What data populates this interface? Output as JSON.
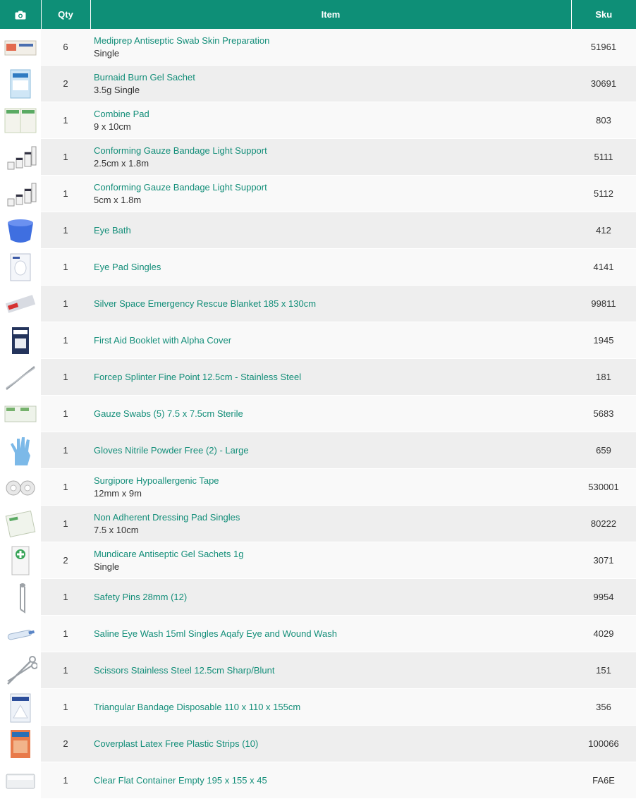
{
  "header": {
    "camera_icon": "camera-icon",
    "qty": "Qty",
    "item": "Item",
    "sku": "Sku"
  },
  "colors": {
    "header_bg": "#0e8f77",
    "link": "#138e79"
  },
  "rows": [
    {
      "qty": "6",
      "name": "Mediprep Antiseptic Swab Skin Preparation",
      "variant": "Single",
      "sku": "51961",
      "icon": "swab-box-icon"
    },
    {
      "qty": "2",
      "name": "Burnaid Burn Gel Sachet",
      "variant": "3.5g Single",
      "sku": "30691",
      "icon": "gel-sachet-icon"
    },
    {
      "qty": "1",
      "name": "Combine Pad",
      "variant": "9 x 10cm",
      "sku": "803",
      "icon": "combine-pad-icon"
    },
    {
      "qty": "1",
      "name": "Conforming Gauze Bandage Light Support",
      "variant": "2.5cm x 1.8m",
      "sku": "5111",
      "icon": "bandage-rolls-icon"
    },
    {
      "qty": "1",
      "name": "Conforming Gauze Bandage Light Support",
      "variant": "5cm x 1.8m",
      "sku": "5112",
      "icon": "bandage-rolls-icon"
    },
    {
      "qty": "1",
      "name": "Eye Bath",
      "variant": "",
      "sku": "412",
      "icon": "eye-bath-icon"
    },
    {
      "qty": "1",
      "name": "Eye Pad Singles",
      "variant": "",
      "sku": "4141",
      "icon": "eye-pad-icon"
    },
    {
      "qty": "1",
      "name": "Silver Space Emergency Rescue Blanket 185 x 130cm",
      "variant": "",
      "sku": "99811",
      "icon": "rescue-blanket-icon"
    },
    {
      "qty": "1",
      "name": "First Aid Booklet with Alpha Cover",
      "variant": "",
      "sku": "1945",
      "icon": "booklet-icon"
    },
    {
      "qty": "1",
      "name": "Forcep Splinter Fine Point 12.5cm - Stainless Steel",
      "variant": "",
      "sku": "181",
      "icon": "forceps-icon"
    },
    {
      "qty": "1",
      "name": "Gauze Swabs (5) 7.5 x 7.5cm Sterile",
      "variant": "",
      "sku": "5683",
      "icon": "gauze-swabs-icon"
    },
    {
      "qty": "1",
      "name": "Gloves Nitrile Powder Free (2) - Large",
      "variant": "",
      "sku": "659",
      "icon": "glove-icon"
    },
    {
      "qty": "1",
      "name": "Surgipore Hypoallergenic Tape",
      "variant": "12mm x 9m",
      "sku": "530001",
      "icon": "tape-icon"
    },
    {
      "qty": "1",
      "name": "Non Adherent Dressing Pad Singles",
      "variant": "7.5 x 10cm",
      "sku": "80222",
      "icon": "dressing-pad-icon"
    },
    {
      "qty": "2",
      "name": "Mundicare Antiseptic Gel Sachets 1g",
      "variant": "Single",
      "sku": "3071",
      "icon": "antiseptic-sachet-icon"
    },
    {
      "qty": "1",
      "name": "Safety Pins 28mm (12)",
      "variant": "",
      "sku": "9954",
      "icon": "safety-pin-icon"
    },
    {
      "qty": "1",
      "name": "Saline Eye Wash 15ml Singles Aqafy Eye and Wound Wash",
      "variant": "",
      "sku": "4029",
      "icon": "eye-wash-icon"
    },
    {
      "qty": "1",
      "name": "Scissors Stainless Steel 12.5cm Sharp/Blunt",
      "variant": "",
      "sku": "151",
      "icon": "scissors-icon"
    },
    {
      "qty": "1",
      "name": "Triangular Bandage Disposable 110 x 110 x 155cm",
      "variant": "",
      "sku": "356",
      "icon": "triangular-bandage-icon"
    },
    {
      "qty": "2",
      "name": "Coverplast Latex Free Plastic Strips (10)",
      "variant": "",
      "sku": "100066",
      "icon": "plastic-strips-icon"
    },
    {
      "qty": "1",
      "name": "Clear Flat Container Empty 195 x 155 x 45",
      "variant": "",
      "sku": "FA6E",
      "icon": "container-icon"
    }
  ]
}
